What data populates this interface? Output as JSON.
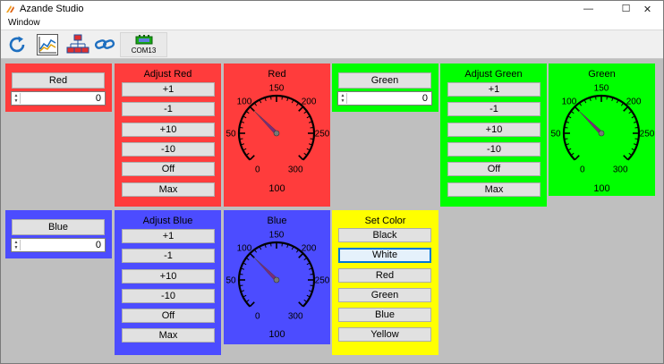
{
  "window": {
    "title": "Azande Studio",
    "controls": {
      "minimize": "—",
      "maximize": "☐",
      "close": "✕"
    }
  },
  "menu": {
    "items": [
      "Window"
    ]
  },
  "toolbar": {
    "buttons": [
      {
        "icon": "refresh-icon"
      },
      {
        "icon": "chart-icon"
      },
      {
        "icon": "network-icon"
      },
      {
        "icon": "link-icon"
      }
    ],
    "com": {
      "icon": "serial-port-icon",
      "label": "COM13"
    }
  },
  "colors": {
    "red": "#ff3c3c",
    "green": "#00ff00",
    "blue": "#4c4cff",
    "yellow": "#ffff00",
    "workspace": "#bfbfbf"
  },
  "red": {
    "input_label": "Red",
    "input_value": "0",
    "adjust_title": "Adjust Red",
    "adjust_buttons": [
      "+1",
      "-1",
      "+10",
      "-10",
      "Off",
      "Max"
    ],
    "gauge_title": "Red",
    "gauge_readout": "100"
  },
  "green": {
    "input_label": "Green",
    "input_value": "0",
    "adjust_title": "Adjust Green",
    "adjust_buttons": [
      "+1",
      "-1",
      "+10",
      "-10",
      "Off",
      "Max"
    ],
    "gauge_title": "Green",
    "gauge_readout": "100"
  },
  "blue": {
    "input_label": "Blue",
    "input_value": "0",
    "adjust_title": "Adjust Blue",
    "adjust_buttons": [
      "+1",
      "-1",
      "+10",
      "-10",
      "Off",
      "Max"
    ],
    "gauge_title": "Blue",
    "gauge_readout": "100"
  },
  "gauge": {
    "min": 0,
    "max": 300,
    "tick_labels": [
      "0",
      "50",
      "100",
      "150",
      "200",
      "250",
      "300"
    ],
    "value": 100
  },
  "set_color": {
    "title": "Set Color",
    "buttons": [
      "Black",
      "White",
      "Red",
      "Green",
      "Blue",
      "Yellow"
    ],
    "focused": "White"
  }
}
